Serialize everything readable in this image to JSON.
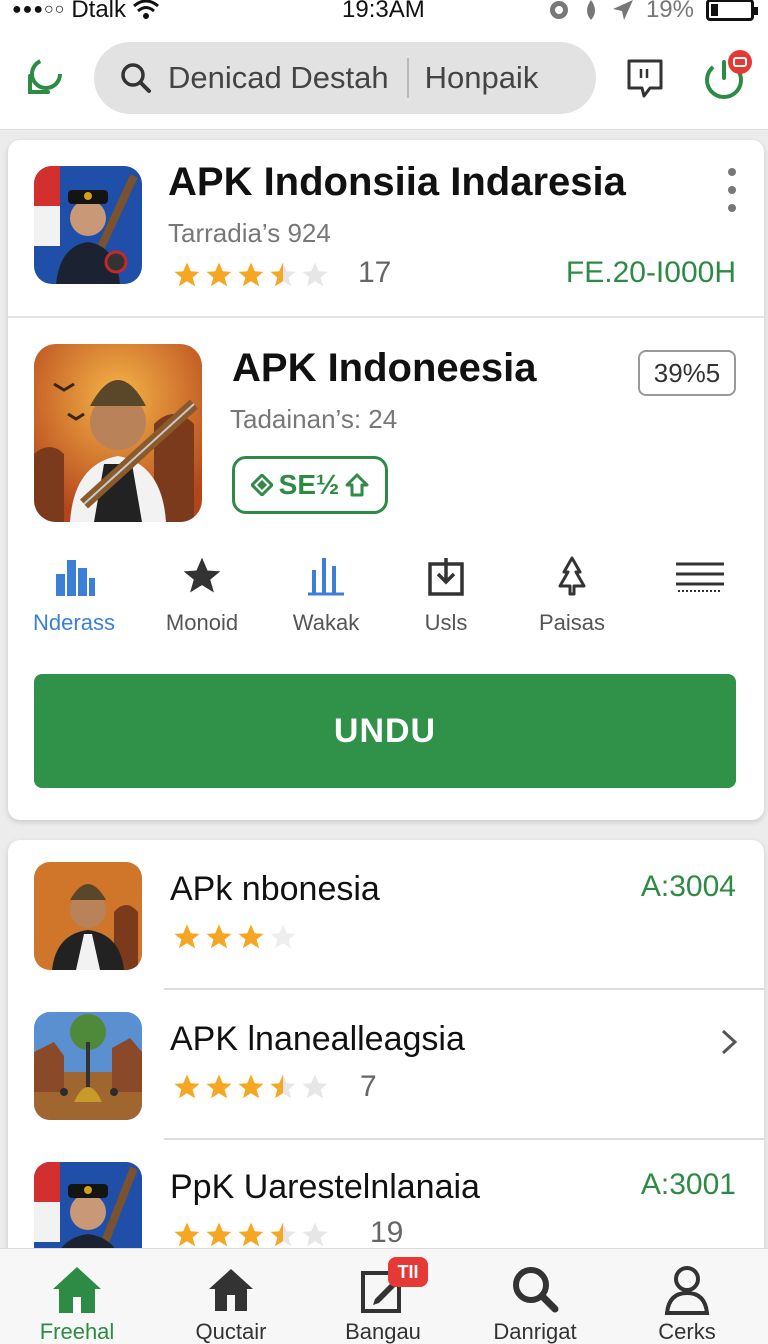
{
  "status_bar": {
    "carrier": "Dtalk",
    "time": "19:3AM",
    "battery": "19%",
    "battery_level": 0.19
  },
  "header": {
    "search_query": "Denicad  Destah",
    "search_secondary": "Honpaik"
  },
  "featured": {
    "app1": {
      "title": "APK Indonsiia Indaresia",
      "subtitle": "Tarradia’s 924",
      "rating": 3.5,
      "review_count": "17",
      "price_text": "FE.20-I000H"
    },
    "app2": {
      "title": "APK Indoneesia",
      "subtitle": "Tadainan’s: 24",
      "badge": "39%5",
      "tag_label": "SE½",
      "tag_icon_left": "diamond-icon",
      "tag_icon_right": "home-up-icon"
    },
    "tabs": [
      {
        "label": "Nderass",
        "icon": "bar-chart-icon",
        "active": true
      },
      {
        "label": "Monoid",
        "icon": "star-icon",
        "active": false
      },
      {
        "label": "Wakak",
        "icon": "stats-icon",
        "active": false
      },
      {
        "label": "Usls",
        "icon": "download-icon",
        "active": false
      },
      {
        "label": "Paisas",
        "icon": "tree-icon",
        "active": false
      },
      {
        "label": "",
        "icon": "menu-icon",
        "active": false
      }
    ],
    "install_label": "UNDU",
    "colors": {
      "accent_green": "#2f9248",
      "tab_active": "#3b7fd6",
      "star": "#f5a623"
    }
  },
  "list": [
    {
      "title": "APk nbonesia",
      "rating": 3,
      "count": "",
      "right_text": "A:3004",
      "chevron": false
    },
    {
      "title": "APK lnanealleagsia",
      "rating": 3.5,
      "count": "7",
      "right_text": "",
      "chevron": true
    },
    {
      "title": "PpK Uarestelnlanaia",
      "rating": 3.5,
      "count": "19",
      "right_text": "A:3001",
      "chevron": false
    }
  ],
  "bottom_nav": [
    {
      "label": "Freehal",
      "icon": "home-icon",
      "active": true
    },
    {
      "label": "Quctair",
      "icon": "home-outline-icon",
      "active": false
    },
    {
      "label": "Bangau",
      "icon": "edit-icon",
      "active": false,
      "badge": "TII"
    },
    {
      "label": "Danrigat",
      "icon": "search-icon",
      "active": false
    },
    {
      "label": "Cerks",
      "icon": "profile-icon",
      "active": false
    }
  ]
}
